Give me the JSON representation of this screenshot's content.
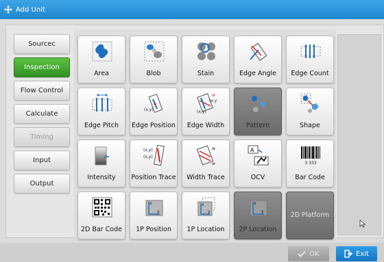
{
  "window": {
    "title": "Add Unit",
    "title_icon": "move-arrows-icon"
  },
  "sidebar": {
    "items": [
      {
        "label": "Sourcec",
        "state": "normal"
      },
      {
        "label": "Inspection",
        "state": "active"
      },
      {
        "label": "Flow Control",
        "state": "normal"
      },
      {
        "label": "Calculate",
        "state": "normal"
      },
      {
        "label": "Timing",
        "state": "disabled"
      },
      {
        "label": "Input",
        "state": "normal"
      },
      {
        "label": "Output",
        "state": "normal"
      }
    ]
  },
  "tools": [
    {
      "label": "Area",
      "icon": "area-icon"
    },
    {
      "label": "Blob",
      "icon": "blob-icon"
    },
    {
      "label": "Stain",
      "icon": "stain-icon"
    },
    {
      "label": "Edge Angle",
      "icon": "edge-angle-icon"
    },
    {
      "label": "Edge Count",
      "icon": "edge-count-icon"
    },
    {
      "label": "Edge Pitch",
      "icon": "edge-pitch-icon"
    },
    {
      "label": "Edge Position",
      "icon": "edge-position-icon"
    },
    {
      "label": "Edge Width",
      "icon": "edge-width-icon"
    },
    {
      "label": "Pattern",
      "icon": "pattern-icon",
      "disabled": true
    },
    {
      "label": "Shape",
      "icon": "shape-icon"
    },
    {
      "label": "Intensity",
      "icon": "intensity-icon"
    },
    {
      "label": "Position Trace",
      "icon": "position-trace-icon"
    },
    {
      "label": "Width Trace",
      "icon": "width-trace-icon"
    },
    {
      "label": "OCV",
      "icon": "ocv-icon"
    },
    {
      "label": "Bar Code",
      "icon": "barcode-icon",
      "barcode_text": "3 333"
    },
    {
      "label": "2D Bar Code",
      "icon": "qr-code-icon"
    },
    {
      "label": "1P Position",
      "icon": "1p-position-icon"
    },
    {
      "label": "1P Location",
      "icon": "1p-location-icon"
    },
    {
      "label": "2P Location",
      "icon": "2p-location-icon",
      "disabled": true
    },
    {
      "label": "2D Platform",
      "icon": "",
      "disabled": true
    }
  ],
  "icon_text": {
    "xy": "(x,y)",
    "w": "w",
    "a": "A",
    "x": "x",
    "y": "y"
  },
  "footer": {
    "ok_label": "OK",
    "exit_label": "Exit"
  },
  "colors": {
    "title_bar": "#1f86cf",
    "active": "#3aa12b",
    "exit": "#1677c6"
  }
}
